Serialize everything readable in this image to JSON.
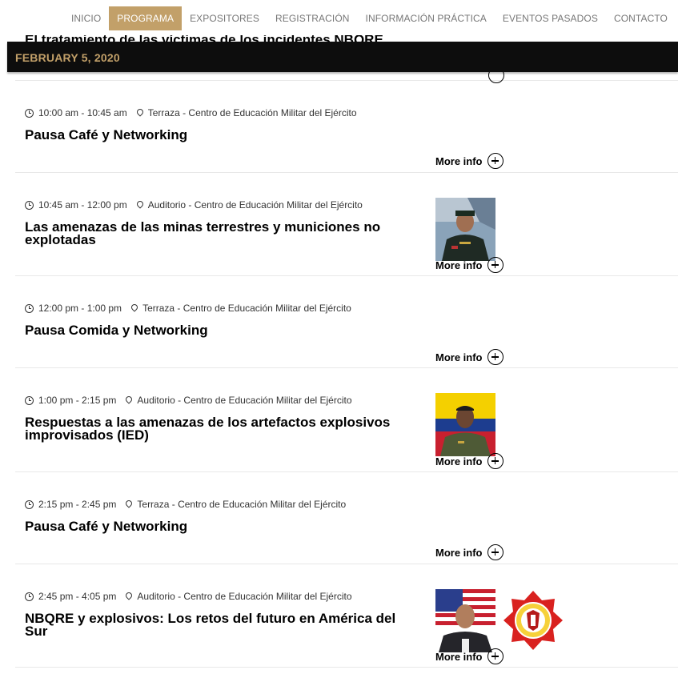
{
  "nav": {
    "items": [
      "INICIO",
      "PROGRAMA",
      "EXPOSITORES",
      "REGISTRACIÓN",
      "INFORMACIÓN PRÁCTICA",
      "EVENTOS PASADOS",
      "CONTACTO"
    ],
    "active": "PROGRAMA"
  },
  "partial_title": "El tratamiento de las víctimas de los incidentes NBQRE",
  "date_bar": "FEBRUARY 5, 2020",
  "more_info_label": "More info",
  "sessions": [
    {
      "time": "10:00 am - 10:45 am",
      "location": "Terraza - Centro de Educación Militar del Ejército",
      "title": "Pausa Café y Networking"
    },
    {
      "time": "10:45 am - 12:00 pm",
      "location": "Auditorio - Centro de Educación Militar del Ejército",
      "title": "Las amenazas de las minas terrestres y municiones no explotadas"
    },
    {
      "time": "12:00 pm - 1:00 pm",
      "location": "Terraza - Centro de Educación Militar del Ejército",
      "title": "Pausa Comida y Networking"
    },
    {
      "time": "1:00 pm - 2:15 pm",
      "location": "Auditorio - Centro de Educación Militar del Ejército",
      "title": "Respuestas a las amenazas de los artefactos explosivos improvisados (IED)"
    },
    {
      "time": "2:15 pm - 2:45 pm",
      "location": "Terraza - Centro de Educación Militar del Ejército",
      "title": "Pausa Café y Networking"
    },
    {
      "time": "2:45 pm - 4:05 pm",
      "location": "Auditorio - Centro de Educación Militar del Ejército",
      "title": "NBQRE y explosivos: Los retos del futuro en América del Sur"
    }
  ],
  "colors": {
    "accent": "#c2a069",
    "date_bar_bg": "#0d0d0d",
    "nav_text": "#777777"
  }
}
